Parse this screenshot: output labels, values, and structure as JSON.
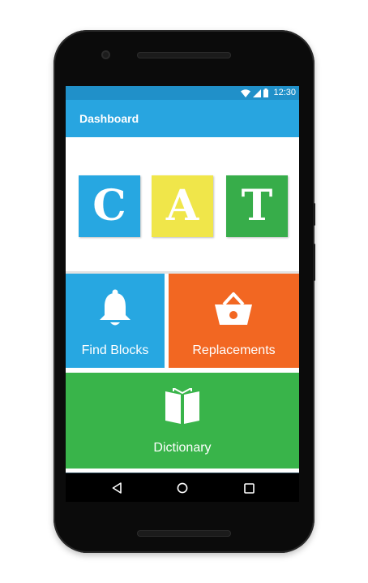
{
  "status_bar": {
    "time": "12:30",
    "icons": [
      "wifi-icon",
      "signal-icon",
      "battery-icon"
    ]
  },
  "app_bar": {
    "title": "Dashboard"
  },
  "hero": {
    "letters": [
      {
        "char": "C",
        "color": "#27a7e1"
      },
      {
        "char": "A",
        "color": "#f0e64a"
      },
      {
        "char": "T",
        "color": "#37ad4a"
      }
    ]
  },
  "tiles": {
    "find_blocks": {
      "label": "Find Blocks",
      "icon": "bell-icon",
      "color": "#27a7e1"
    },
    "replacements": {
      "label": "Replacements",
      "icon": "basket-icon",
      "color": "#f26722"
    },
    "dictionary": {
      "label": "Dictionary",
      "icon": "book-icon",
      "color": "#39b44a"
    }
  },
  "nav": {
    "icons": [
      "back-icon",
      "home-icon",
      "recents-icon"
    ]
  }
}
